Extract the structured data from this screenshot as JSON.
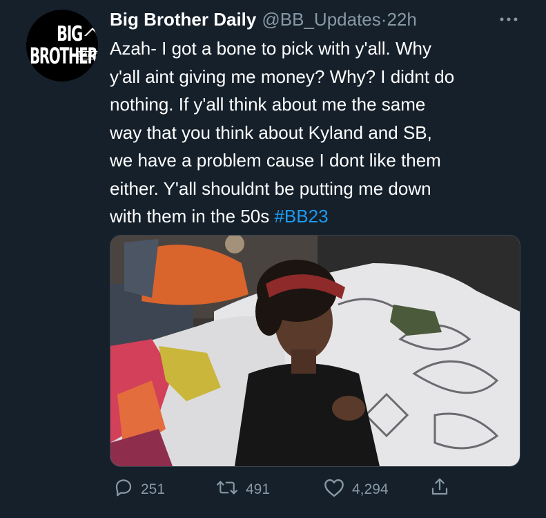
{
  "account": {
    "display_name": "Big Brother Daily",
    "handle": "@BB_Updates",
    "separator": " · ",
    "time": "22h",
    "avatar_logo": {
      "line1": "BIG",
      "line2": "BROTHER",
      "line3": "DAILY"
    }
  },
  "tweet": {
    "lines": [
      "Azah- I got a bone to pick with y'all. Why",
      "y'all aint giving me money? Why? I didnt do",
      "nothing. If y'all think about me the same",
      "way that you think about Kyland and SB,",
      "we have a problem cause I dont like them",
      "either. Y'all shouldnt be putting me down"
    ],
    "last_line_text": "with them in the 50s ",
    "hashtag": "#BB23"
  },
  "stats": {
    "replies": "251",
    "retweets": "491",
    "likes": "4,294"
  },
  "icons": {
    "more": "more-icon",
    "reply": "reply-icon",
    "retweet": "retweet-icon",
    "like": "heart-icon",
    "share": "share-icon"
  },
  "colors": {
    "background": "#15202b",
    "text": "#ffffff",
    "secondary_text": "#8899a6",
    "link": "#1d9bf0"
  }
}
